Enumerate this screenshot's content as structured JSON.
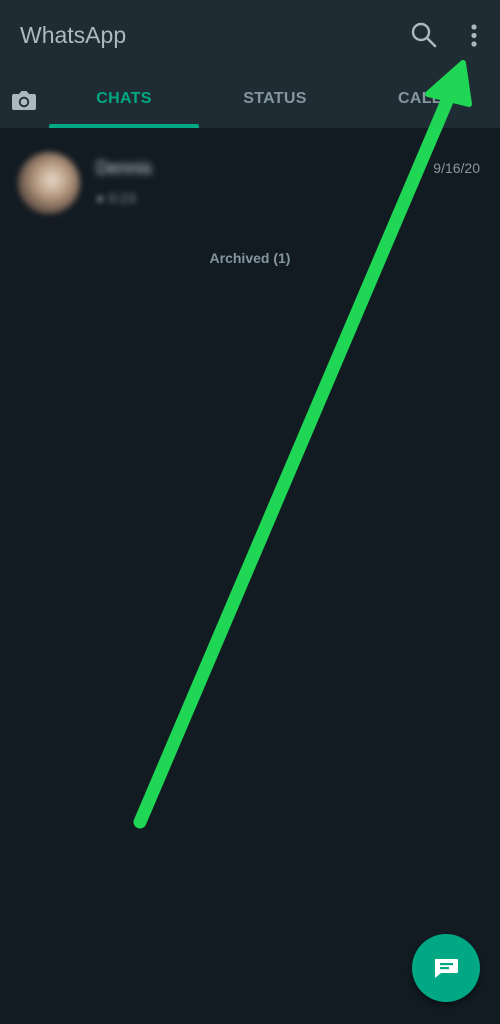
{
  "app": {
    "title": "WhatsApp"
  },
  "toolbar": {
    "search_icon": "search-icon",
    "menu_icon": "more-vertical-icon"
  },
  "tabs": [
    {
      "label": "",
      "icon": "camera-icon",
      "selected": false
    },
    {
      "label": "CHATS",
      "selected": true
    },
    {
      "label": "STATUS",
      "selected": false
    },
    {
      "label": "CALLS",
      "selected": false
    }
  ],
  "chats": [
    {
      "name": "Dennis",
      "preview": "0:23",
      "time": "9/16/20",
      "avatar": "contact-photo"
    }
  ],
  "archived": {
    "label": "Archived (1)"
  },
  "fab": {
    "icon": "new-chat-icon"
  },
  "annotation": {
    "arrow_color": "#1fd655",
    "target": "more-vertical-icon"
  },
  "colors": {
    "background": "#121b22",
    "header": "#1f2c34",
    "accent": "#00a884",
    "muted_text": "#8696a0"
  }
}
